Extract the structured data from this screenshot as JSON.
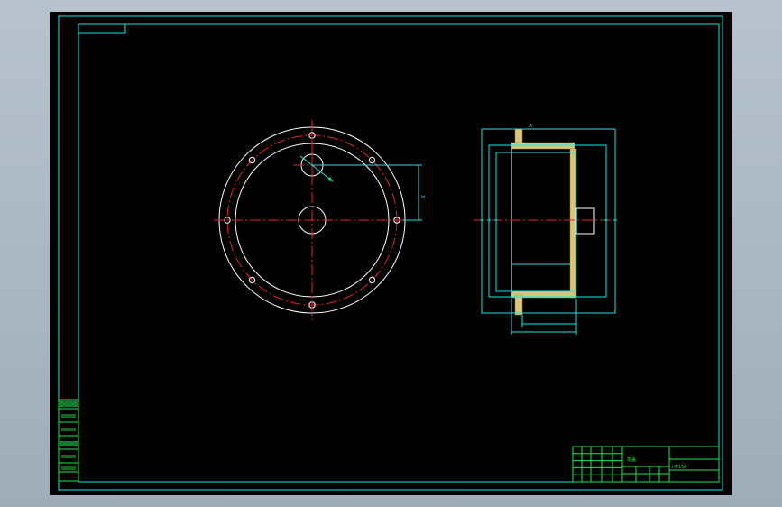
{
  "colors": {
    "background": "#000000",
    "frame": "#1ee3e3",
    "outline": "#ffffff",
    "centerline": "#e4222b",
    "titleblock": "#22e64a",
    "section_hatch": "#d9c47a"
  },
  "drawing": {
    "front_view": {
      "bolt_holes": 8
    },
    "dimension_marks": [
      "X",
      "X"
    ]
  },
  "title_block": {
    "title": "端盖",
    "material": "HT150"
  },
  "side_table": {
    "rows": [
      "",
      "",
      "",
      "",
      "",
      ""
    ]
  }
}
